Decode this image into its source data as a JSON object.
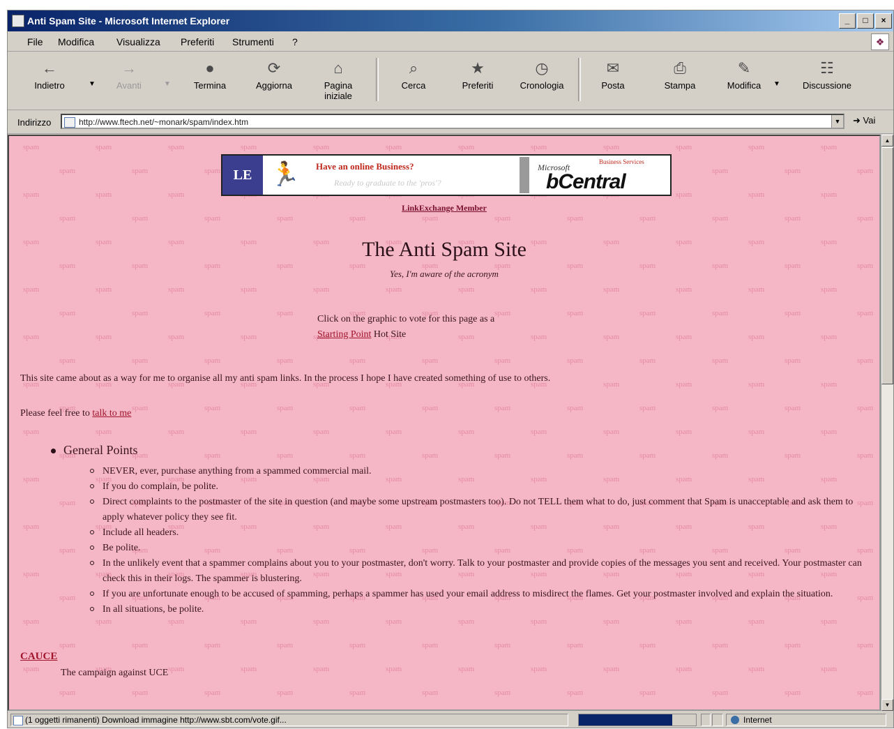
{
  "window": {
    "title": "Anti Spam Site - Microsoft Internet Explorer",
    "buttons": [
      "_",
      "□",
      "×"
    ]
  },
  "menu": [
    "File",
    "Modifica",
    "Visualizza",
    "Preferiti",
    "Strumenti",
    "?"
  ],
  "toolbar": {
    "back": "Indietro",
    "forward": "Avanti",
    "stop": "Termina",
    "refresh": "Aggiorna",
    "home": "Pagina iniziale",
    "search": "Cerca",
    "favorites": "Preferiti",
    "history": "Cronologia",
    "mail": "Posta",
    "print": "Stampa",
    "edit": "Modifica",
    "discuss": "Discussione"
  },
  "address": {
    "label": "Indirizzo",
    "url": "http://www.ftech.net/~monark/spam/index.htm",
    "go": "Vai"
  },
  "banner": {
    "headline": "Have an online Business?",
    "sub": "Ready to graduate to the 'pros'?",
    "brand_small": "Microsoft",
    "brand": "bCentral",
    "tag": "Business Services",
    "link": "LinkExchange Member"
  },
  "page": {
    "title": "The Anti Spam Site",
    "tagline": "Yes, I'm aware of the acronym",
    "vote_prefix": "Click on the graphic to vote for this page as a",
    "vote_link": "Starting Point",
    "vote_suffix": "Hot Site",
    "intro": "This site came about as a way for me to organise all my anti spam links. In the process I hope I have created something of use to others.",
    "feel_prefix": "Please feel free to",
    "feel_link": "talk to me",
    "section": "General Points",
    "points": [
      "NEVER, ever, purchase anything from a spammed commercial mail.",
      "If you do complain, be polite.",
      "Direct complaints to the postmaster of the site in question (and maybe some upstream postmasters too). Do not TELL them what to do, just comment that Spam is unacceptable and ask them to apply whatever policy they see fit.",
      "Include all headers.",
      "Be polite.",
      "In the unlikely event that a spammer complains about you to your postmaster, don't worry. Talk to your postmaster and provide copies of the messages you sent and received. Your postmaster can check this in their logs. The spammer is blustering.",
      "If you are unfortunate enough to be accused of spamming, perhaps a spammer has used your email address to misdirect the flames. Get your postmaster involved and explain the situation.",
      "In all situations, be polite."
    ],
    "cause_link": "CAUCE",
    "cause_desc": "The campaign against UCE",
    "bg_word": "spam"
  },
  "status": {
    "message": "(1 oggetti rimanenti) Download immagine http://www.sbt.com/vote.gif...",
    "progress": 0.8,
    "zone": "Internet"
  }
}
